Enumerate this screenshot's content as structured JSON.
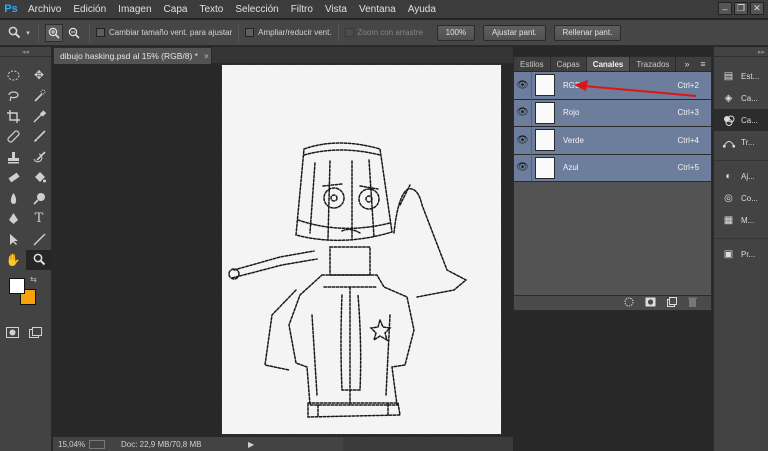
{
  "app": {
    "logo": "Ps"
  },
  "menu": [
    "Archivo",
    "Edición",
    "Imagen",
    "Capa",
    "Texto",
    "Selección",
    "Filtro",
    "Vista",
    "Ventana",
    "Ayuda"
  ],
  "window_controls": [
    "–",
    "❐",
    "✕"
  ],
  "options": {
    "tool_icon": "zoom-tool-icon",
    "zoom_in_icon": "zoom-in-icon",
    "zoom_out_icon": "zoom-out-icon",
    "resize_windows": "Cambiar tamaño vent. para ajustar",
    "zoom_all_windows": "Ampliar/reducir vent.",
    "scrubby_zoom": "Zoom con arrastre",
    "btn_100": "100%",
    "btn_fit": "Ajustar pant.",
    "btn_fill": "Rellenar pant."
  },
  "document": {
    "tab_title": "dibujo hasking.psd al 15% (RGB/8) *",
    "tab_close": "×"
  },
  "status": {
    "zoom": "15,04%",
    "doc_info": "Doc: 22,9 MB/70,8 MB",
    "arrow": "▶"
  },
  "panel": {
    "tabs": [
      "Estilos",
      "Capas",
      "Canales",
      "Trazados"
    ],
    "active_tab": "Canales",
    "collapse": "»",
    "menu_icon": "≡",
    "channels": [
      {
        "name": "RGB",
        "shortcut": "Ctrl+2"
      },
      {
        "name": "Rojo",
        "shortcut": "Ctrl+3"
      },
      {
        "name": "Verde",
        "shortcut": "Ctrl+4"
      },
      {
        "name": "Azul",
        "shortcut": "Ctrl+5"
      }
    ],
    "footer_icons": [
      "load-channel-selection-icon",
      "save-selection-icon",
      "new-channel-icon",
      "delete-channel-icon"
    ]
  },
  "dock": {
    "items": [
      {
        "label": "Est...",
        "icon": "properties-icon"
      },
      {
        "label": "Ca...",
        "icon": "layers-icon"
      },
      {
        "label": "Ca...",
        "icon": "channels-icon",
        "active": true
      },
      {
        "label": "Tr...",
        "icon": "paths-icon"
      },
      {
        "label": "Aj...",
        "icon": "adjustments-icon"
      },
      {
        "label": "Co...",
        "icon": "color-icon"
      },
      {
        "label": "M...",
        "icon": "swatches-icon"
      },
      {
        "label": "Pr...",
        "icon": "presets-icon"
      }
    ]
  },
  "colors": {
    "foreground": "#ffffff",
    "background": "#f7a20a",
    "channel_highlight": "#6d7e9c",
    "annotation_arrow": "#e01414"
  }
}
